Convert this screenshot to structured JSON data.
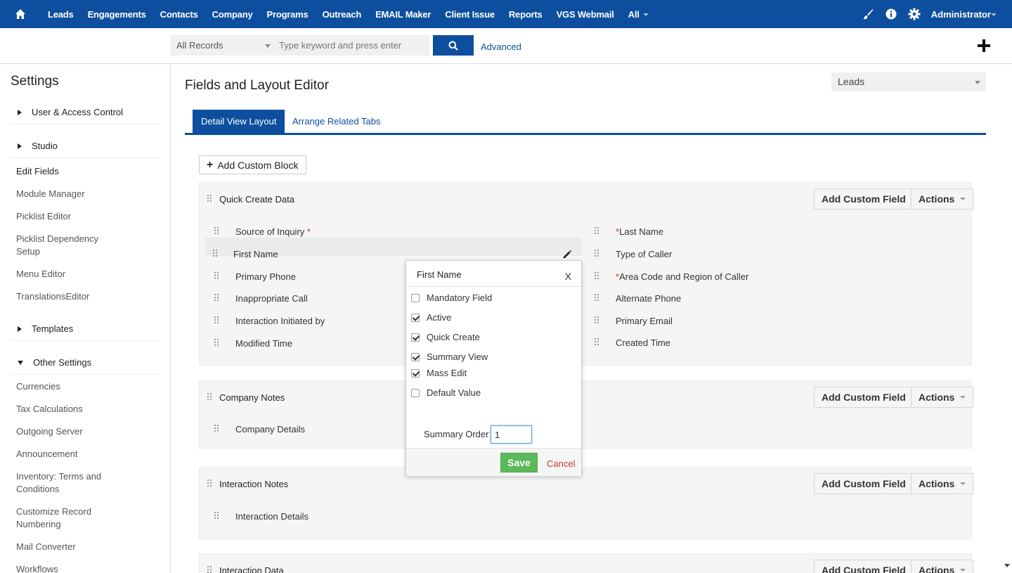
{
  "topnav": {
    "items": [
      "Leads",
      "Engagements",
      "Contacts",
      "Company",
      "Programs",
      "Outreach",
      "EMAIL Maker",
      "Client Issue",
      "Reports",
      "VGS Webmail",
      "All"
    ],
    "user": "Administrator"
  },
  "search": {
    "scope": "All Records",
    "placeholder": "Type keyword and press enter",
    "advanced": "Advanced"
  },
  "sidebar": {
    "title": "Settings",
    "groups": [
      "User & Access Control",
      "Studio",
      "Templates",
      "Other Settings"
    ],
    "studio_links": [
      "Edit Fields",
      "Module Manager",
      "Picklist Editor",
      "Picklist Dependency Setup",
      "Menu Editor",
      "TranslationsEditor"
    ],
    "other_links": [
      "Currencies",
      "Tax Calculations",
      "Outgoing Server",
      "Announcement",
      "Inventory: Terms and Conditions",
      "Customize Record Numbering",
      "Mail Converter",
      "Workflows"
    ]
  },
  "main": {
    "title": "Fields and Layout Editor",
    "module": "Leads",
    "tabs": [
      "Detail View Layout",
      "Arrange Related Tabs"
    ],
    "add_block": "Add Custom Block",
    "add_field": "Add Custom Field",
    "actions": "Actions",
    "blocks": [
      {
        "title": "Quick Create Data",
        "left_fields": [
          "Source of Inquiry",
          "First Name",
          "Primary Phone",
          "Inappropriate Call",
          "Interaction Initiated by",
          "Modified Time"
        ],
        "right_fields": [
          "Last Name",
          "Type of Caller",
          "Area Code and Region of Caller",
          "Alternate Phone",
          "Primary Email",
          "Created Time"
        ]
      },
      {
        "title": "Company Notes",
        "left_fields": [
          "Company Details"
        ]
      },
      {
        "title": "Interaction Notes",
        "left_fields": [
          "Interaction Details"
        ]
      },
      {
        "title": "Interaction Data"
      }
    ],
    "required_marker": "*"
  },
  "modal": {
    "title": "First Name",
    "close": "X",
    "options": [
      {
        "label": "Mandatory Field",
        "checked": false
      },
      {
        "label": "Active",
        "checked": true
      },
      {
        "label": "Quick Create",
        "checked": true
      },
      {
        "label": "Summary View",
        "checked": true
      },
      {
        "label": "Mass Edit",
        "checked": true
      },
      {
        "label": "Default Value",
        "checked": false
      }
    ],
    "summary_order_label": "Summary Order",
    "summary_order_value": "1",
    "save": "Save",
    "cancel": "Cancel"
  },
  "colors": {
    "brand": "#0d4f9e",
    "save": "#5cb85c",
    "required": "#c0392b"
  }
}
